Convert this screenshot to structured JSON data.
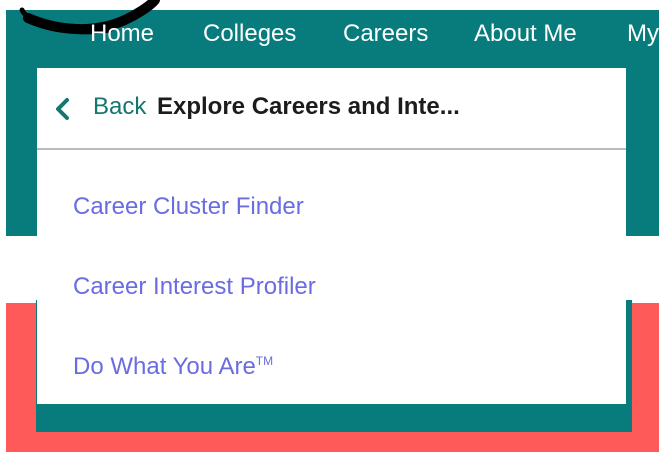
{
  "nav": {
    "items": [
      "Home",
      "Colleges",
      "Careers",
      "About Me",
      "My"
    ]
  },
  "menu": {
    "back_label": "Back",
    "title": "Explore Careers and Inte...",
    "items": [
      {
        "label": "Career Cluster Finder"
      },
      {
        "label": "Career Interest Profiler"
      },
      {
        "label": "Do What You Are",
        "suffix": "TM"
      }
    ]
  },
  "icons": {
    "back": "chevron-left-icon"
  },
  "colors": {
    "teal": "#087b7d",
    "link": "#6a6ce0",
    "highlight": "#ff5a5a",
    "back_text": "#14766f"
  }
}
